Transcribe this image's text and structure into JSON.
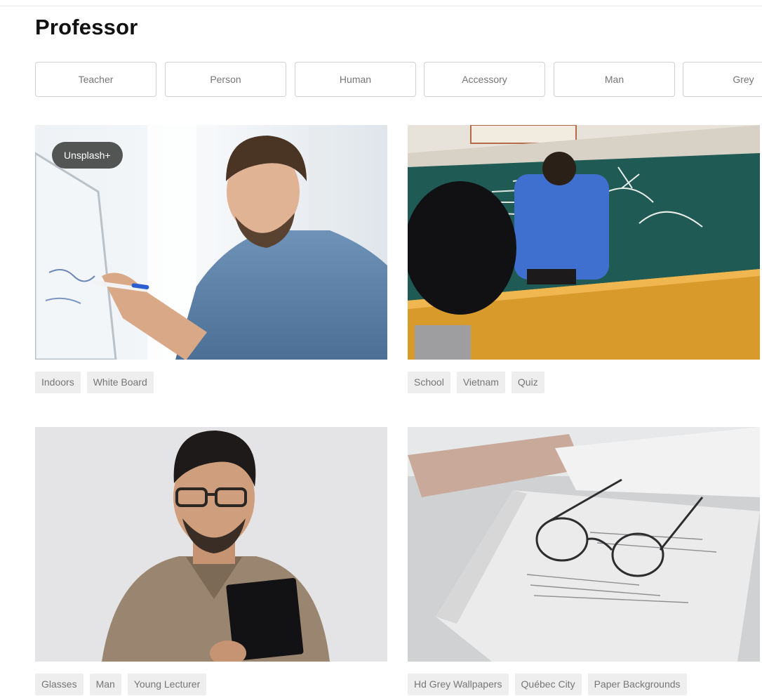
{
  "page": {
    "title": "Professor"
  },
  "related_searches": [
    "Teacher",
    "Person",
    "Human",
    "Accessory",
    "Man",
    "Grey"
  ],
  "photos": [
    {
      "badge": "Unsplash+",
      "tags": [
        "Indoors",
        "White Board"
      ]
    },
    {
      "badge": "",
      "tags": [
        "School",
        "Vietnam",
        "Quiz"
      ]
    },
    {
      "badge": "",
      "tags": [
        "Glasses",
        "Man",
        "Young Lecturer"
      ]
    },
    {
      "badge": "",
      "tags": [
        "Hd Grey Wallpapers",
        "Québec City",
        "Paper Backgrounds"
      ]
    }
  ],
  "colors": {
    "chip_border": "#d1d1d1",
    "chip_text": "#767676",
    "tag_bg": "#eeeeee",
    "badge_bg": "#373737"
  }
}
